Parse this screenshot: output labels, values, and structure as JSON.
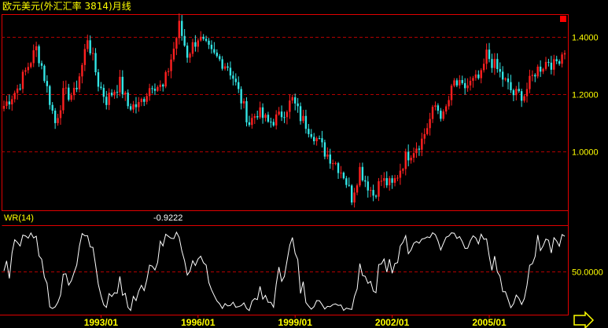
{
  "title": "欧元美元(外汇汇率 3814)月线",
  "colors": {
    "up": "#ff2020",
    "down": "#33e6e6",
    "indicator_line": "#ffffff",
    "axis": "#e10000",
    "grid": "#b40000",
    "text": "#ffff00",
    "background": "#000000"
  },
  "icons": {
    "corner_marker": "red-square",
    "scroll_button": "right-arrow-icon"
  },
  "indicator": {
    "name": "WR(14)",
    "value": "-0.9222"
  },
  "chart_data": [
    {
      "type": "candlestick",
      "title": "欧元美元(外汇汇率 3814)月线",
      "period": "monthly",
      "ylim": [
        0.8,
        1.475
      ],
      "yticks": [
        "1.4000",
        "1.2000",
        "1.0000"
      ],
      "xticks": [
        "1993/01",
        "1996/01",
        "1999/01",
        "2002/01",
        "2005/01"
      ],
      "grid": true,
      "anchors": [
        [
          "1990/01",
          1.16
        ],
        [
          "1990/06",
          1.22
        ],
        [
          "1991/01",
          1.36
        ],
        [
          "1991/03",
          1.3
        ],
        [
          "1991/08",
          1.1
        ],
        [
          "1991/11",
          1.2
        ],
        [
          "1992/03",
          1.2
        ],
        [
          "1992/06",
          1.3
        ],
        [
          "1992/08",
          1.4
        ],
        [
          "1992/12",
          1.24
        ],
        [
          "1993/03",
          1.18
        ],
        [
          "1993/08",
          1.24
        ],
        [
          "1993/11",
          1.16
        ],
        [
          "1994/03",
          1.16
        ],
        [
          "1994/08",
          1.24
        ],
        [
          "1994/12",
          1.22
        ],
        [
          "1995/04",
          1.36
        ],
        [
          "1995/06",
          1.44
        ],
        [
          "1995/09",
          1.34
        ],
        [
          "1996/01",
          1.4
        ],
        [
          "1996/06",
          1.34
        ],
        [
          "1996/12",
          1.3
        ],
        [
          "1997/02",
          1.26
        ],
        [
          "1997/08",
          1.1
        ],
        [
          "1997/11",
          1.14
        ],
        [
          "1998/03",
          1.1
        ],
        [
          "1998/07",
          1.12
        ],
        [
          "1998/12",
          1.18
        ],
        [
          "1999/03",
          1.12
        ],
        [
          "1999/08",
          1.06
        ],
        [
          "1999/12",
          1.0
        ],
        [
          "2000/04",
          0.96
        ],
        [
          "2000/07",
          0.92
        ],
        [
          "2000/10",
          0.84
        ],
        [
          "2001/01",
          0.94
        ],
        [
          "2001/03",
          0.9
        ],
        [
          "2001/06",
          0.85
        ],
        [
          "2001/09",
          0.9
        ],
        [
          "2002/01",
          0.88
        ],
        [
          "2002/06",
          0.98
        ],
        [
          "2002/12",
          1.04
        ],
        [
          "2003/05",
          1.16
        ],
        [
          "2003/08",
          1.12
        ],
        [
          "2003/12",
          1.24
        ],
        [
          "2004/03",
          1.22
        ],
        [
          "2004/10",
          1.26
        ],
        [
          "2004/12",
          1.34
        ],
        [
          "2005/03",
          1.3
        ],
        [
          "2005/10",
          1.2
        ],
        [
          "2006/02",
          1.2
        ],
        [
          "2006/06",
          1.28
        ],
        [
          "2006/11",
          1.32
        ],
        [
          "2007/01",
          1.3
        ],
        [
          "2007/05",
          1.36
        ]
      ]
    },
    {
      "type": "line",
      "name": "WR(14)",
      "last_value": -0.9222,
      "ylim": [
        0,
        105
      ],
      "yticks": [
        "50.0000"
      ]
    }
  ]
}
